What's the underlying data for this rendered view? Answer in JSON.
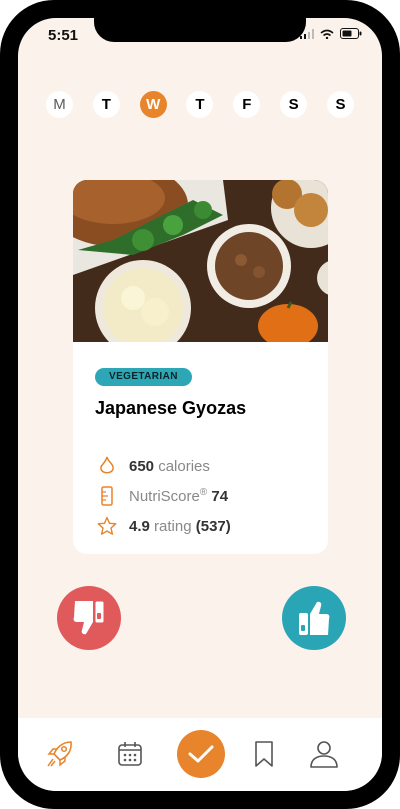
{
  "status_bar": {
    "time": "5:51"
  },
  "week": {
    "days": [
      {
        "label": "M",
        "state": "muted"
      },
      {
        "label": "T",
        "state": "normal"
      },
      {
        "label": "W",
        "state": "active"
      },
      {
        "label": "T",
        "state": "normal"
      },
      {
        "label": "F",
        "state": "normal"
      },
      {
        "label": "S",
        "state": "normal"
      },
      {
        "label": "S",
        "state": "normal"
      }
    ]
  },
  "recipe": {
    "tag": "VEGETARIAN",
    "title": "Japanese Gyozas",
    "calories_value": "650",
    "calories_label": "calories",
    "nutriscore_label": "NutriScore",
    "nutriscore_value": "74",
    "rating_value": "4.9",
    "rating_label": "rating",
    "rating_count": "(537)"
  },
  "actions": {
    "dislike_icon": "thumbs-down-icon",
    "like_icon": "thumbs-up-icon"
  },
  "tab_bar": {
    "items": [
      "rocket-icon",
      "calendar-icon",
      "check-icon",
      "bookmark-icon",
      "profile-icon"
    ],
    "active": "check-icon"
  },
  "colors": {
    "accent": "#e8842b",
    "teal": "#2aa5b5",
    "red": "#e15a5b",
    "background": "#fbf2eb"
  }
}
